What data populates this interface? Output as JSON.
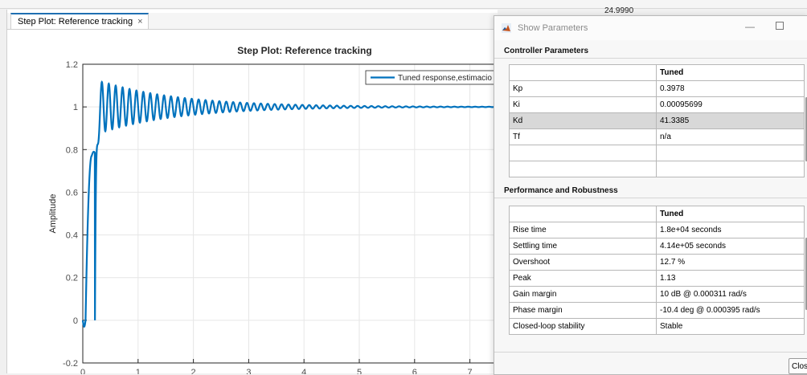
{
  "background_window": {
    "side_value": "24.9990"
  },
  "plot_window": {
    "tab_label": "Step Plot: Reference tracking",
    "close_glyph": "×"
  },
  "chart_data": {
    "type": "line",
    "title": "Step Plot: Reference tracking",
    "ylabel": "Amplitude",
    "xlabel": "",
    "xlim": [
      0,
      7.5
    ],
    "ylim": [
      -0.2,
      1.2
    ],
    "xticks": [
      0,
      1,
      2,
      3,
      4,
      5,
      6,
      7
    ],
    "yticks": [
      -0.2,
      0,
      0.2,
      0.4,
      0.6,
      0.8,
      1.0,
      1.2
    ],
    "ytick_labels": [
      "-0.2",
      "0",
      "0.2",
      "0.4",
      "0.6",
      "0.8",
      "1",
      "1.2"
    ],
    "grid": true,
    "legend_placement": "top-right",
    "series": [
      {
        "name": "Tuned response,estimacio",
        "color": "#0072bd",
        "shape": {
          "initial_dip": -0.03,
          "plateau": 0.77,
          "peak": 1.13,
          "final": 1.0,
          "oscillation_period": 0.125,
          "decay_rate": 0.7
        }
      }
    ]
  },
  "dialog": {
    "title": "Show  Parameters",
    "minimize_glyph": "—",
    "close_label": "Clos",
    "controller": {
      "section_label": "Controller Parameters",
      "column_header": "Tuned",
      "rows": [
        {
          "name": "Kp",
          "value": "0.3978"
        },
        {
          "name": "Ki",
          "value": "0.00095699"
        },
        {
          "name": "Kd",
          "value": "41.3385"
        },
        {
          "name": "Tf",
          "value": "n/a"
        },
        {
          "name": "",
          "value": ""
        },
        {
          "name": "",
          "value": ""
        }
      ]
    },
    "performance": {
      "section_label": "Performance and Robustness",
      "column_header": "Tuned",
      "rows": [
        {
          "name": "Rise time",
          "value": "1.8e+04 seconds"
        },
        {
          "name": "Settling time",
          "value": "4.14e+05 seconds"
        },
        {
          "name": "Overshoot",
          "value": "12.7 %"
        },
        {
          "name": "Peak",
          "value": "1.13"
        },
        {
          "name": "Gain margin",
          "value": "10 dB @ 0.000311 rad/s"
        },
        {
          "name": "Phase margin",
          "value": "-10.4 deg @ 0.000395 rad/s"
        },
        {
          "name": "Closed-loop stability",
          "value": "Stable"
        }
      ]
    }
  }
}
